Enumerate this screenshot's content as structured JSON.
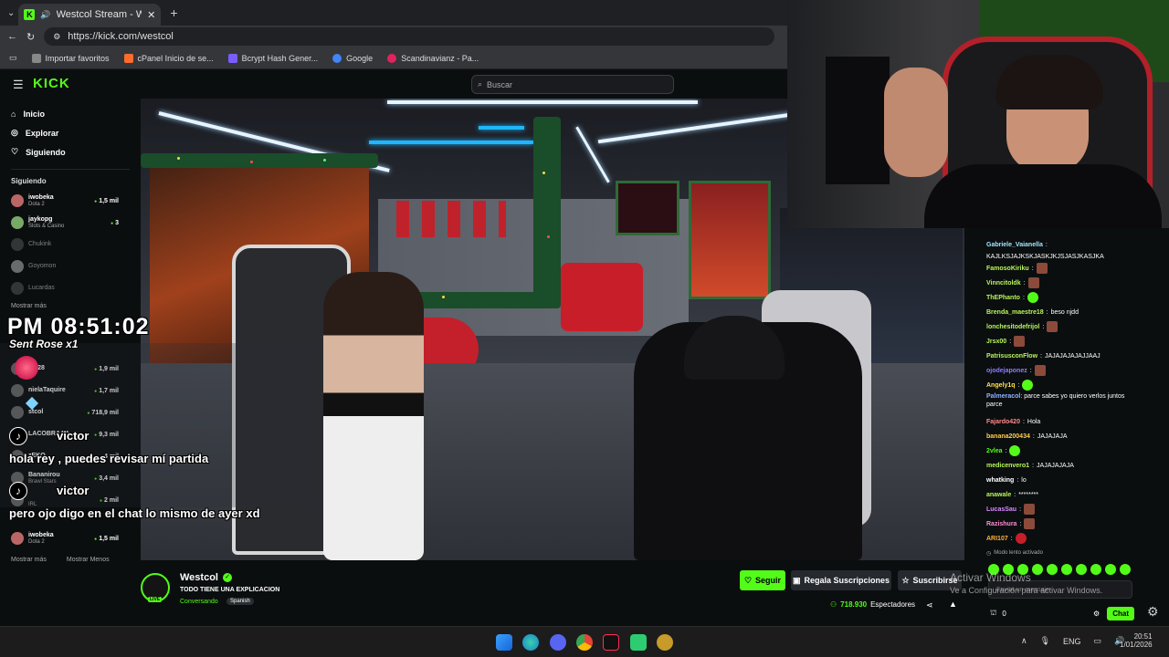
{
  "browser": {
    "tab_title": "Westcol Stream - Watch Live",
    "url": "https://kick.com/westcol",
    "bookmarks": [
      {
        "label": "Importar favoritos",
        "color": "#888888"
      },
      {
        "label": "cPanel Inicio de se...",
        "color": "#ff6c2c"
      },
      {
        "label": "Bcrypt Hash Gener...",
        "color": "#7b5cff"
      },
      {
        "label": "Google",
        "color": "#4285f4"
      },
      {
        "label": "Scandinavianz - Pa...",
        "color": "#e0245e"
      }
    ]
  },
  "kick": {
    "logo": "KICK",
    "search_placeholder": "Buscar",
    "nav": [
      {
        "label": "Inicio",
        "icon": "home-icon"
      },
      {
        "label": "Explorar",
        "icon": "compass-icon"
      },
      {
        "label": "Siguiendo",
        "icon": "heart-icon"
      }
    ],
    "following_header": "Siguiendo",
    "following": [
      {
        "name": "iwobeka",
        "category": "Dota 2",
        "count": "1,5 mil",
        "live": true
      },
      {
        "name": "jaykopg",
        "category": "Slots & Casino",
        "count": "3",
        "live": true
      },
      {
        "name": "Chukink",
        "category": "",
        "count": "",
        "live": false
      },
      {
        "name": "Goyomon",
        "category": "",
        "count": "",
        "live": false
      },
      {
        "name": "Lucardas",
        "category": "",
        "count": "",
        "live": false
      }
    ],
    "show_more": "Mostrar más",
    "show_less": "Mostrar Menos",
    "bottom_channel": {
      "name": "iwobeka",
      "category": "Dota 2",
      "count": "1,5 mil"
    }
  },
  "overlay": {
    "clock": "PM 08:51:02",
    "gift": "Sent Rose x1",
    "user1": "victor",
    "msg1": "hola rey , puedes revisar mí partida",
    "user2": "victor",
    "msg2": "pero ojo digo en el chat lo mismo de ayer xd",
    "hidden_rows": [
      {
        "name": "lus28",
        "count": "1,9 mil"
      },
      {
        "name": "nielaTaquire",
        "count": "1,7 mil"
      },
      {
        "name": "stcol",
        "count": "718,9 mil"
      },
      {
        "name": "LACOBRAAA",
        "count": "9,3 mil"
      },
      {
        "name": "zEKO",
        "count": "4 mil"
      },
      {
        "name": "Bananirou",
        "count": "3,4 mil"
      },
      {
        "name": "",
        "count": "2 mil"
      }
    ],
    "extra_tags": {
      "a": "2 mil",
      "b": "Brawl Stars",
      "c": "IRL"
    }
  },
  "stream": {
    "channel": "Westcol",
    "title": "TODO TIENE UNA EXPLICACION",
    "category": "Conversando",
    "language": "Spanish",
    "follow": "Seguir",
    "gift_subs": "Regala Suscripciones",
    "subscribe": "Suscribirse",
    "viewers": "718.930",
    "viewers_label": "Espectadores",
    "live_badge": "LIVE"
  },
  "chat": {
    "messages": [
      {
        "user": "Gabriele_Vaianella",
        "color": "#a3e4ff",
        "text": "",
        "emote": ""
      },
      {
        "user": "",
        "color": "#ffffff",
        "text": "KAJLKSJAJKSKJASKJKJSJASJKASJKA",
        "emote": ""
      },
      {
        "user": "FamosoKiriku",
        "color": "#b7f55a",
        "text": "",
        "emote": "brown"
      },
      {
        "user": "Vinncitoldk",
        "color": "#b7f55a",
        "text": "",
        "emote": "brown"
      },
      {
        "user": "ThEPhanto",
        "color": "#b7f55a",
        "text": "",
        "emote": "green"
      },
      {
        "user": "Brenda_maestre18",
        "color": "#b7f55a",
        "text": "beso njdd",
        "emote": ""
      },
      {
        "user": "lonchesitodefrijol",
        "color": "#b7f55a",
        "text": "",
        "emote": "brown"
      },
      {
        "user": "Jrsx00",
        "color": "#b7f55a",
        "text": "",
        "emote": "brown"
      },
      {
        "user": "PatrisusconFlow",
        "color": "#b7f55a",
        "text": "JAJAJAJAJAJJAAJ",
        "emote": ""
      },
      {
        "user": "ojodejaponez",
        "color": "#8a7dff",
        "text": "",
        "emote": "brown"
      },
      {
        "user": "Angely1q",
        "color": "#ffe14d",
        "text": "",
        "emote": "green"
      },
      {
        "user": "Palmeracol",
        "color": "#8fb4ff",
        "text": "parce sabes yo quiero verlos juntos parce",
        "emote": ""
      },
      {
        "user": "Fajardo420",
        "color": "#ff8a8a",
        "text": "Hola",
        "emote": ""
      },
      {
        "user": "banana200434",
        "color": "#ffcf4d",
        "text": "JAJAJAJA",
        "emote": ""
      },
      {
        "user": "2vlea",
        "color": "#53fc18",
        "text": "",
        "emote": "green"
      },
      {
        "user": "medicenvero1",
        "color": "#b7f55a",
        "text": "JAJAJAJAJA",
        "emote": ""
      },
      {
        "user": "whatking",
        "color": "#ffffff",
        "text": "lo",
        "emote": ""
      },
      {
        "user": "anawale",
        "color": "#b7f55a",
        "text": "********",
        "emote": ""
      },
      {
        "user": "LucasSau",
        "color": "#d98aff",
        "text": "",
        "emote": "brown"
      },
      {
        "user": "Razishura",
        "color": "#ff8ad0",
        "text": "",
        "emote": "brown"
      },
      {
        "user": "ARI107",
        "color": "#ffb13b",
        "text": "",
        "emote": "red"
      }
    ],
    "slow_mode": "Modo lento activado",
    "input_placeholder": "Enviar un mensaje",
    "count": "0",
    "send": "Chat"
  },
  "windows": {
    "watermark1": "Activar Windows",
    "watermark2": "Ve a Configuración para activar Windows.",
    "lang": "ENG",
    "time": "20:51",
    "date": "1/01/2026"
  }
}
